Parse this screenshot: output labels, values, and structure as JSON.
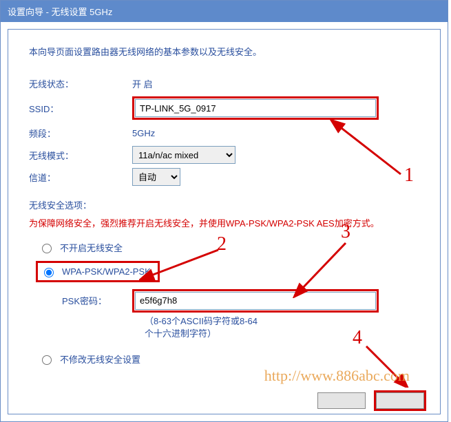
{
  "title": "设置向导 - 无线设置 5GHz",
  "intro": "本向导页面设置路由器无线网络的基本参数以及无线安全。",
  "labels": {
    "status": "无线状态：",
    "ssid": "SSID：",
    "band": "频段：",
    "mode": "无线模式：",
    "channel": "信道："
  },
  "values": {
    "status": "开  启",
    "ssid": "TP-LINK_5G_0917",
    "band": "5GHz",
    "mode_selected": "11a/n/ac mixed",
    "channel_selected": "自动"
  },
  "security": {
    "section_label": "无线安全选项：",
    "warning": "为保障网络安全，强烈推荐开启无线安全，并使用WPA-PSK/WPA2-PSK AES加密方式。",
    "opt_off": "不开启无线安全",
    "opt_wpa": "WPA-PSK/WPA2-PSK",
    "psk_label": "PSK密码：",
    "psk_value": "e5f6g7h8",
    "psk_hint_line1": "（8-63个ASCII码字符或8-64",
    "psk_hint_line2": "个十六进制字符）",
    "opt_keep": "不修改无线安全设置"
  },
  "annotations": {
    "n1": "1",
    "n2": "2",
    "n3": "3",
    "n4": "4"
  },
  "watermark": "http://www.886abc.com"
}
